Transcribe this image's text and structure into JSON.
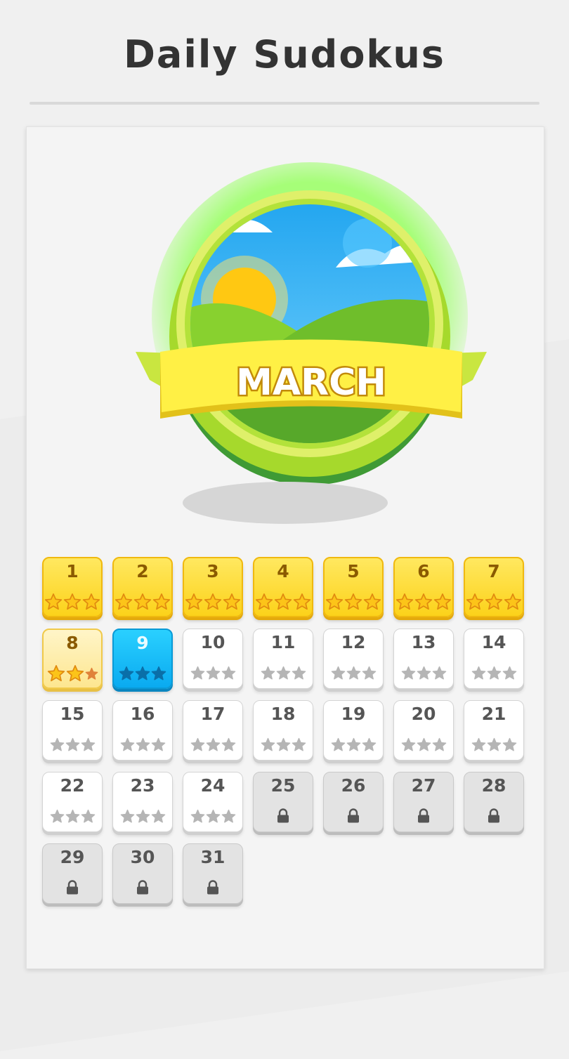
{
  "header": {
    "title": "Daily Sudokus"
  },
  "badge": {
    "month": "MARCH"
  },
  "calendar": {
    "days": [
      {
        "day": "1",
        "state": "gold",
        "stars": 3
      },
      {
        "day": "2",
        "state": "gold",
        "stars": 3
      },
      {
        "day": "3",
        "state": "gold",
        "stars": 3
      },
      {
        "day": "4",
        "state": "gold",
        "stars": 3
      },
      {
        "day": "5",
        "state": "gold",
        "stars": 3
      },
      {
        "day": "6",
        "state": "gold",
        "stars": 3
      },
      {
        "day": "7",
        "state": "gold",
        "stars": 3
      },
      {
        "day": "8",
        "state": "partial",
        "stars": 2
      },
      {
        "day": "9",
        "state": "current",
        "stars": 0
      },
      {
        "day": "10",
        "state": "open",
        "stars": 0
      },
      {
        "day": "11",
        "state": "open",
        "stars": 0
      },
      {
        "day": "12",
        "state": "open",
        "stars": 0
      },
      {
        "day": "13",
        "state": "open",
        "stars": 0
      },
      {
        "day": "14",
        "state": "open",
        "stars": 0
      },
      {
        "day": "15",
        "state": "open",
        "stars": 0
      },
      {
        "day": "16",
        "state": "open",
        "stars": 0
      },
      {
        "day": "17",
        "state": "open",
        "stars": 0
      },
      {
        "day": "18",
        "state": "open",
        "stars": 0
      },
      {
        "day": "19",
        "state": "open",
        "stars": 0
      },
      {
        "day": "20",
        "state": "open",
        "stars": 0
      },
      {
        "day": "21",
        "state": "open",
        "stars": 0
      },
      {
        "day": "22",
        "state": "open",
        "stars": 0
      },
      {
        "day": "23",
        "state": "open",
        "stars": 0
      },
      {
        "day": "24",
        "state": "open",
        "stars": 0
      },
      {
        "day": "25",
        "state": "locked",
        "stars": 0
      },
      {
        "day": "26",
        "state": "locked",
        "stars": 0
      },
      {
        "day": "27",
        "state": "locked",
        "stars": 0
      },
      {
        "day": "28",
        "state": "locked",
        "stars": 0
      },
      {
        "day": "29",
        "state": "locked",
        "stars": 0
      },
      {
        "day": "30",
        "state": "locked",
        "stars": 0
      },
      {
        "day": "31",
        "state": "locked",
        "stars": 0
      }
    ]
  },
  "colors": {
    "star_gold": "#fcc419",
    "star_gold_edge": "#e08a10",
    "star_bronze": "#e0823a",
    "star_grey": "#b5b5b5",
    "star_current": "#0a6fa8",
    "lock": "#555555"
  },
  "icons": {
    "star": "star-icon",
    "lock": "lock-icon"
  }
}
